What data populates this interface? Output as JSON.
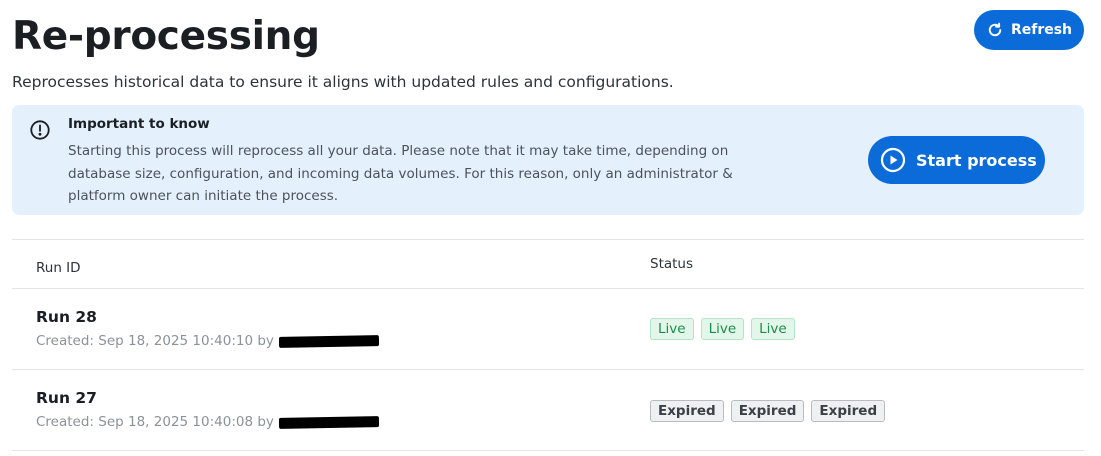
{
  "header": {
    "title": "Re-processing",
    "subtitle": "Reprocesses historical data to ensure it aligns with updated rules and configurations.",
    "refresh_label": "Refresh"
  },
  "notice": {
    "heading": "Important to know",
    "text": "Starting this process will reprocess all your data. Please note that it may take time, depending on database size, configuration, and incoming data volumes. For this reason, only an administrator & platform owner can initiate the process.",
    "start_label": "Start process",
    "icon": "info-icon"
  },
  "table": {
    "columns": {
      "run_id": "Run ID",
      "status": "Status"
    },
    "rows": [
      {
        "title": "Run 28",
        "created": "Created: Sep 18, 2025 10:40:10 by",
        "statuses": [
          "Live",
          "Live",
          "Live"
        ],
        "kind": "live"
      },
      {
        "title": "Run 27",
        "created": "Created: Sep 18, 2025 10:40:08 by",
        "statuses": [
          "Expired",
          "Expired",
          "Expired"
        ],
        "kind": "expired"
      }
    ]
  },
  "colors": {
    "primary": "#0b6bd8",
    "notice_bg": "#e4f1fd",
    "live": "#1e8a4c"
  }
}
